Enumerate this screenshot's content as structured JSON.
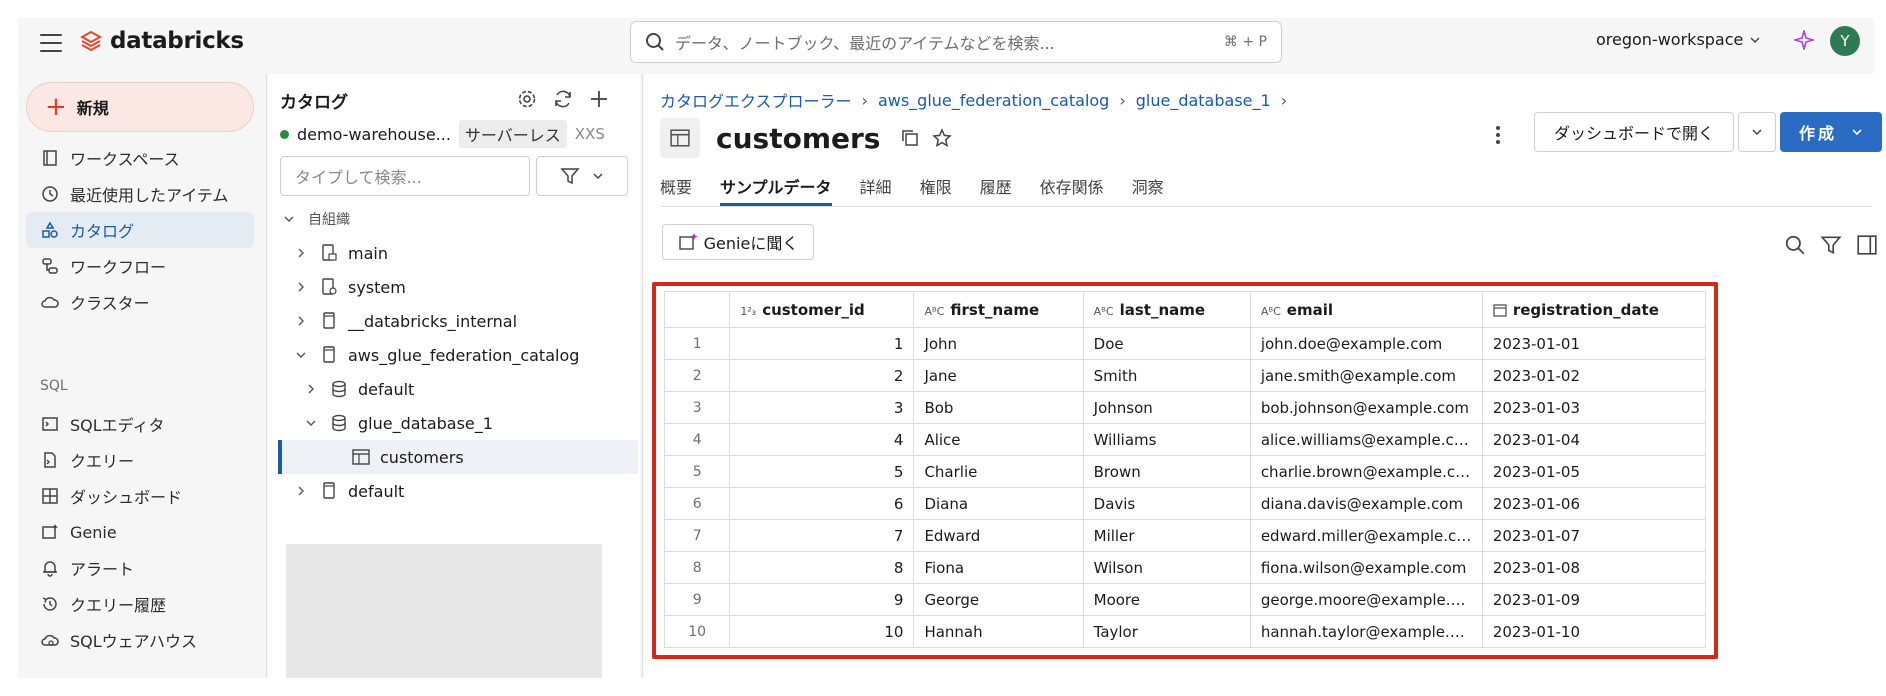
{
  "topbar": {
    "brand": "databricks",
    "search_placeholder": "データ、ノートブック、最近のアイテムなどを検索...",
    "search_shortcut": "⌘ + P",
    "workspace": "oregon-workspace",
    "avatar_letter": "Y"
  },
  "leftnav": {
    "new_label": "新規",
    "items": [
      {
        "label": "ワークスペース",
        "icon": "workspace-icon"
      },
      {
        "label": "最近使用したアイテム",
        "icon": "clock-icon"
      },
      {
        "label": "カタログ",
        "icon": "catalog-icon"
      },
      {
        "label": "ワークフロー",
        "icon": "workflow-icon"
      },
      {
        "label": "クラスター",
        "icon": "cloud-icon"
      }
    ],
    "sql_section": "SQL",
    "sql_items": [
      {
        "label": "SQLエディタ",
        "icon": "sql-editor-icon"
      },
      {
        "label": "クエリー",
        "icon": "query-icon"
      },
      {
        "label": "ダッシュボード",
        "icon": "dashboard-icon"
      },
      {
        "label": "Genie",
        "icon": "genie-icon"
      },
      {
        "label": "アラート",
        "icon": "bell-icon"
      },
      {
        "label": "クエリー履歴",
        "icon": "history-icon"
      },
      {
        "label": "SQLウェアハウス",
        "icon": "warehouse-icon"
      }
    ]
  },
  "catalog_panel": {
    "title": "カタログ",
    "warehouse_name": "demo-warehouse...",
    "warehouse_type": "サーバーレス",
    "warehouse_size": "XXS",
    "search_placeholder": "タイプして検索...",
    "tree": {
      "group": "自組織",
      "main": "main",
      "system": "system",
      "databricks_internal": "__databricks_internal",
      "glue_catalog": "aws_glue_federation_catalog",
      "glue_default": "default",
      "glue_db": "glue_database_1",
      "customers": "customers",
      "default": "default"
    }
  },
  "main": {
    "breadcrumb": [
      "カタログエクスプローラー",
      "aws_glue_federation_catalog",
      "glue_database_1"
    ],
    "table_name": "customers",
    "open_dashboard": "ダッシュボードで開く",
    "create": "作成",
    "tabs": [
      "概要",
      "サンプルデータ",
      "詳細",
      "権限",
      "履歴",
      "依存関係",
      "洞察"
    ],
    "active_tab": "サンプルデータ",
    "genie_button": "Genieに聞く"
  },
  "sample_table": {
    "columns": [
      {
        "name": "customer_id",
        "type_icon": "1²₃"
      },
      {
        "name": "first_name",
        "type_icon": "A^B_C"
      },
      {
        "name": "last_name",
        "type_icon": "A^B_C"
      },
      {
        "name": "email",
        "type_icon": "A^B_C"
      },
      {
        "name": "registration_date",
        "type_icon": "calendar"
      }
    ],
    "rows": [
      [
        "1",
        "1",
        "John",
        "Doe",
        "john.doe@example.com",
        "2023-01-01"
      ],
      [
        "2",
        "2",
        "Jane",
        "Smith",
        "jane.smith@example.com",
        "2023-01-02"
      ],
      [
        "3",
        "3",
        "Bob",
        "Johnson",
        "bob.johnson@example.com",
        "2023-01-03"
      ],
      [
        "4",
        "4",
        "Alice",
        "Williams",
        "alice.williams@example.com",
        "2023-01-04"
      ],
      [
        "5",
        "5",
        "Charlie",
        "Brown",
        "charlie.brown@example.com",
        "2023-01-05"
      ],
      [
        "6",
        "6",
        "Diana",
        "Davis",
        "diana.davis@example.com",
        "2023-01-06"
      ],
      [
        "7",
        "7",
        "Edward",
        "Miller",
        "edward.miller@example.com",
        "2023-01-07"
      ],
      [
        "8",
        "8",
        "Fiona",
        "Wilson",
        "fiona.wilson@example.com",
        "2023-01-08"
      ],
      [
        "9",
        "9",
        "George",
        "Moore",
        "george.moore@example.co...",
        "2023-01-09"
      ],
      [
        "10",
        "10",
        "Hannah",
        "Taylor",
        "hannah.taylor@example.com",
        "2023-01-10"
      ]
    ],
    "highlight_color": "#d6271c"
  }
}
